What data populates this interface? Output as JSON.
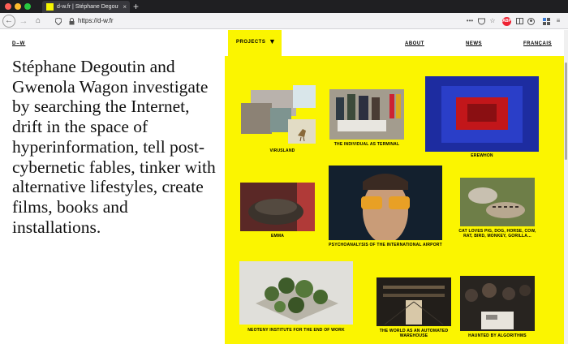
{
  "browser": {
    "tab_title": "d-w.fr | Stéphane Degoutin – Gw...",
    "tab_close": "×",
    "new_tab": "+",
    "url": "https://d-w.fr",
    "back": "←",
    "forward": "→",
    "home": "⌂",
    "more": "•••",
    "extension_badge": "ABP"
  },
  "site": {
    "logo": "D–W",
    "intro": "Stéphane Degoutin and Gwenola Wagon investigate by searching the Internet, drift in the space of hyperinformation, tell post-cybernetic fables, tinker with alternative lifestyles, create films, books and installations.",
    "nav": {
      "projects": "PROJECTS",
      "about": "ABOUT",
      "news": "NEWS",
      "language": "FRANÇAIS"
    }
  },
  "projects": [
    {
      "title": "VIRUSLAND"
    },
    {
      "title": "THE INDIVIDUAL AS TERMINAL"
    },
    {
      "title": "EREWHON"
    },
    {
      "title": "EMMA"
    },
    {
      "title": "PSYCHOANALYSIS OF THE INTERNATIONAL AIRPORT"
    },
    {
      "title": "CAT LOVES PIG, DOG, HORSE, COW, RAT, BIRD, MONKEY, GORILLA..."
    },
    {
      "title": "NEOTENY INSTITUTE FOR THE END OF WORK"
    },
    {
      "title": "THE WORLD AS AN AUTOMATED WAREHOUSE"
    },
    {
      "title": "HAUNTED BY ALGORITHMS"
    }
  ]
}
